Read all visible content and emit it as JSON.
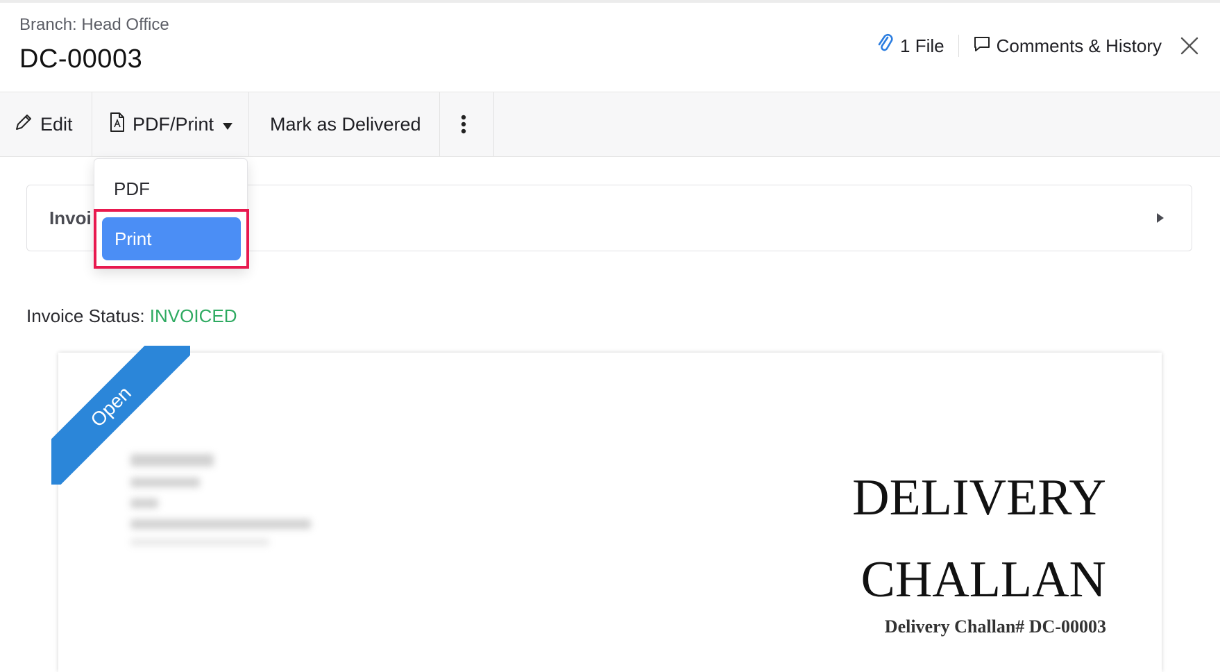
{
  "header": {
    "branch": "Branch: Head Office",
    "title": "DC-00003",
    "files_label": "1 File",
    "comments_label": "Comments & History"
  },
  "toolbar": {
    "edit_label": "Edit",
    "pdf_print_label": "PDF/Print",
    "mark_delivered_label": "Mark as Delivered"
  },
  "dropdown": {
    "items": [
      "PDF",
      "Print"
    ],
    "highlighted": "Print"
  },
  "invoice_row": {
    "label": "Invoi"
  },
  "status": {
    "label": "Invoice Status:",
    "value": "INVOICED",
    "color": "#2eaa61"
  },
  "document": {
    "ribbon": "Open",
    "title_line1": "DELIVERY",
    "title_line2": "CHALLAN",
    "number": "Delivery Challan# DC-00003"
  },
  "colors": {
    "accent": "#4b8ef5",
    "highlight_border": "#e8194f",
    "ribbon": "#2b86d9"
  }
}
